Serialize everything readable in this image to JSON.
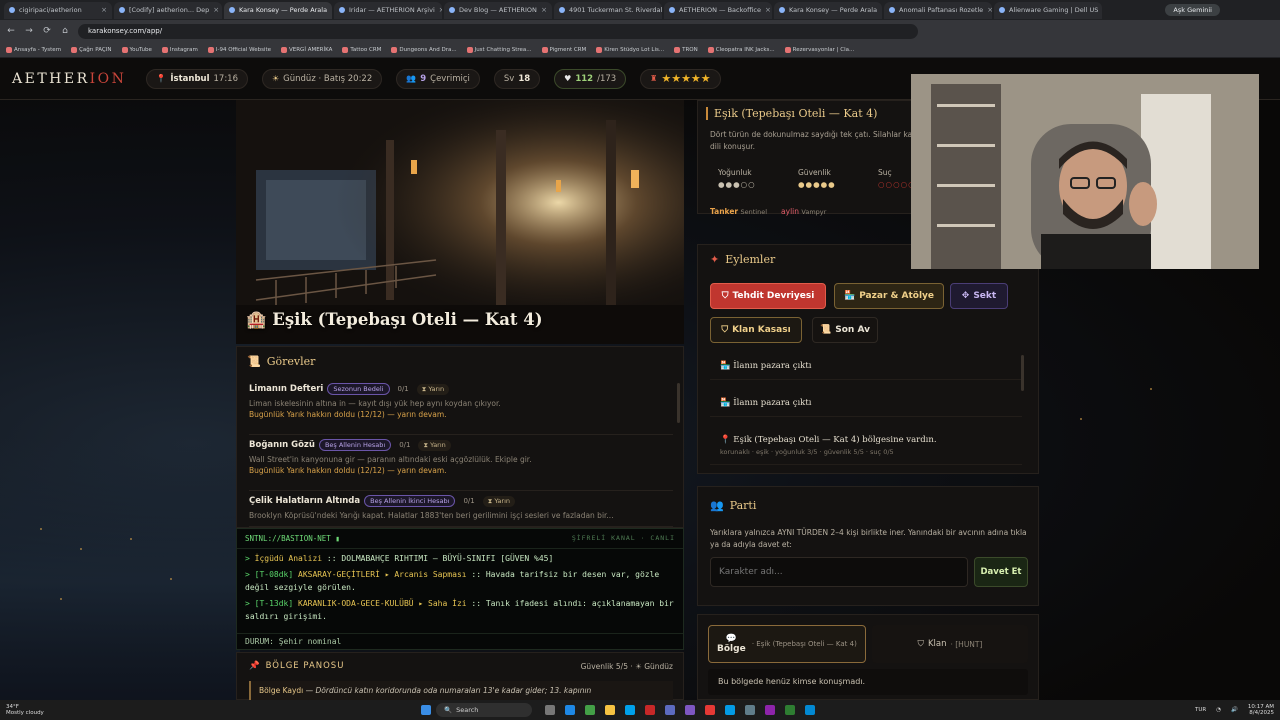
{
  "browser": {
    "tabs": [
      {
        "label": "cigiripaci/aetherion"
      },
      {
        "label": "[Codify] aetherion... Dep"
      },
      {
        "label": "Kara Konsey — Perde Arala",
        "active": true
      },
      {
        "label": "Iridar — AETHERION Arşivi"
      },
      {
        "label": "Dev Blog — AETHERION"
      },
      {
        "label": "4901 Tuckerman St. Riverdal"
      },
      {
        "label": "AETHERION — Backoffice"
      },
      {
        "label": "Kara Konsey — Perde Arala"
      },
      {
        "label": "Anomali Paftanası Rozetle"
      },
      {
        "label": "Alienware Gaming | Dell US"
      }
    ],
    "profile_label": "Aşk Geminii",
    "url": "karakonsey.com/app/",
    "bookmarks": [
      "Ansayfa - Tystem",
      "Çağrı PAÇIN",
      "YouTube",
      "Instagram",
      "I-94 Official Website",
      "VERGİ AMERİKA",
      "Tattoo CRM",
      "Dungeons And Dra...",
      "Just Chatting Strea...",
      "Pigment CRM",
      "Kiren Stüdyo Lot Lis...",
      "TRON",
      "Cleopatra INK Jacks...",
      "Rezervasyonlar | Cla..."
    ]
  },
  "app": {
    "logo_main": "AETHER",
    "logo_accent": "ION",
    "status": {
      "city": "İstanbul",
      "time": "17:16",
      "daypart": "Gündüz · Batış 20:22",
      "online_count": "9",
      "online_label": "Çevrimiçi",
      "level_label": "Sv",
      "level": "18",
      "hp": "112",
      "hp_max": "/173",
      "stars": "★★★★★"
    },
    "hero": {
      "title": "Eşik (Tepebaşı Oteli — Kat 4)"
    },
    "quests": {
      "header": "Görevler",
      "items": [
        {
          "title": "Limanın Defteri",
          "badge": "Sezonun Bedeli",
          "count": "0/1",
          "pill": "Yarın",
          "desc": "Liman iskelesinin altına in — kayıt dışı yük hep aynı koydan çıkıyor.",
          "warn": "Bugünlük Yarık hakkın doldu (12/12) — yarın devam."
        },
        {
          "title": "Boğanın Gözü",
          "badge": "Beş Allenin Hesabı",
          "count": "0/1",
          "pill": "Yarın",
          "desc": "Wall Street'in kanyonuna gir — paranın altındaki eski açgözlülük. Ekiple gir.",
          "warn": "Bugünlük Yarık hakkın doldu (12/12) — yarın devam."
        },
        {
          "title": "Çelik Halatların Altında",
          "badge": "Beş Allenin İkinci Hesabı",
          "count": "0/1",
          "pill": "Yarın",
          "desc": "Brooklyn Köprüsü'ndeki Yarığı kapat. Halatlar 1883'ten beri gerilimini işçi sesleri ve fazladan bir...",
          "warn": ""
        }
      ]
    },
    "terminal": {
      "title": "SNTNL://BASTION-NET ▮",
      "channel": "ŞİFRELİ KANAL · CANLI",
      "lines": [
        {
          "prefix": ">",
          "tag": "İçgüdü Analizi",
          "body": ":: DOLMABAHÇE RIHTIMI — BÜYÜ-SINIFI [GÜVEN %45]"
        },
        {
          "prefix": "> [T-08dk]",
          "tag": "AKSARAY-GEÇİTLERİ ▸ Arcanis Sapması",
          "body": ":: Havada tarifsiz bir desen var, gözle değil sezgiyle görülen."
        },
        {
          "prefix": "> [T-13dk]",
          "tag": "KARANLIK-ODA-GECE-KULÜBÜ ▸ Saha İzi",
          "body": ":: Tanık ifadesi alındı: açıklanamayan bir saldırı girişimi."
        }
      ],
      "status": "DURUM: Şehir nominal"
    },
    "board": {
      "header": "BÖLGE PANOSU",
      "meta": "Güvenlik 5/5 · ☀ Gündüz",
      "entry_label": "Bölge Kaydı",
      "entry": "— Dördüncü katın koridorunda oda numaraları 13'e kadar gider; 13. kapının"
    },
    "zone": {
      "title": "Eşik (Tepebaşı Oteli — Kat 4)",
      "desc": "Dört türün de dokunulmaz saydığı tek çatı. Silahlar kapıda kalır. Burada herkes aynı dili konuşur.",
      "stats": [
        {
          "label": "Yoğunluk",
          "value": "●●●○○"
        },
        {
          "label": "Güvenlik",
          "value": "●●●●●"
        },
        {
          "label": "Suç",
          "value": "○○○○○"
        }
      ],
      "players": [
        {
          "name": "Tanker",
          "role": "Sentinel"
        },
        {
          "name": "aylin",
          "role": "Vampyr"
        }
      ]
    },
    "actions": {
      "header": "Eylemler",
      "buttons": [
        "Tehdit Devriyesi",
        "Pazar & Atölye",
        "Sekt",
        "Klan Kasası",
        "Son Av"
      ],
      "log": [
        "İlanın pazara çıktı",
        "İlanın pazara çıktı",
        "Eşik (Tepebaşı Oteli — Kat 4) bölgesine vardın."
      ],
      "log_sub": "korunaklı · eşik · yoğunluk 3/5 · güvenlik 5/5 · suç 0/5"
    },
    "party": {
      "header": "Parti",
      "desc": "Yarıklara yalnızca AYNI TÜRDEN 2–4 kişi birlikte iner. Yanındaki bir avcının adına tıkla ya da adıyla davet et:",
      "input_placeholder": "Karakter adı...",
      "invite_label": "Davet Et"
    },
    "chat": {
      "tab_region": "Bölge",
      "tab_region_sub": "· Eşik (Tepebaşı Oteli — Kat 4)",
      "tab_clan": "Klan",
      "tab_clan_sub": "· [HUNT]",
      "empty": "Bu bölgede henüz kimse konuşmadı."
    }
  },
  "taskbar": {
    "weather_temp": "34°F",
    "weather_desc": "Mostly cloudy",
    "search_label": "Search",
    "clock_time": "10:17 AM",
    "clock_date": "8/4/2025",
    "lang": "TUR"
  },
  "colors": {
    "accent_red": "#c9453a",
    "gold": "#e9c98a",
    "terminal_green": "#5ad66a",
    "star_gold": "#f0b429"
  }
}
